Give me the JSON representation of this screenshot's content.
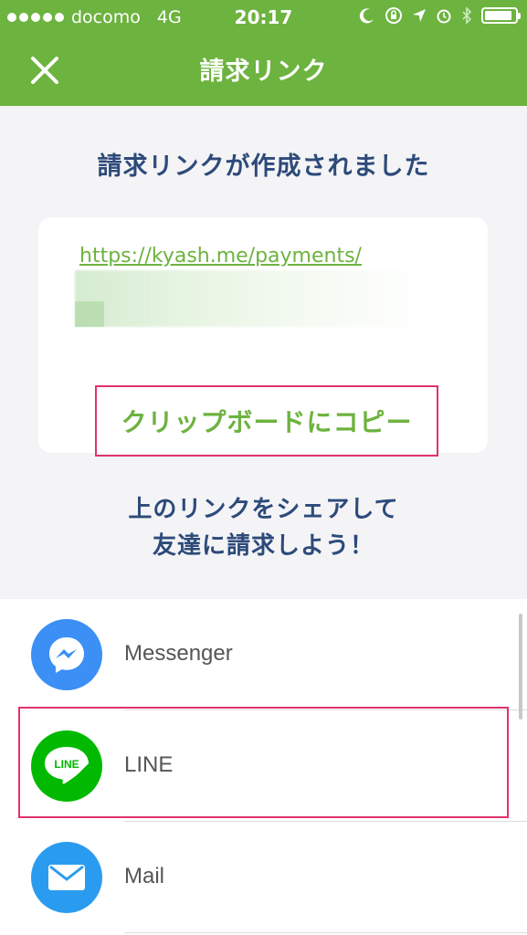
{
  "status_bar": {
    "carrier": "docomo",
    "network": "4G",
    "time": "20:17",
    "battery_level": 0.9
  },
  "nav": {
    "title": "請求リンク",
    "close_icon": "close-icon"
  },
  "main": {
    "headline": "請求リンクが作成されました",
    "link_text": "https://kyash.me/payments/",
    "copy_button_label": "クリップボードにコピー",
    "share_prompt_line1": "上のリンクをシェアして",
    "share_prompt_line2": "友達に請求しよう！"
  },
  "share_options": [
    {
      "label": "Messenger",
      "icon": "messenger-icon",
      "color": "#3b8ff5"
    },
    {
      "label": "LINE",
      "icon": "line-icon",
      "color": "#00b900",
      "icon_text": "LINE"
    },
    {
      "label": "Mail",
      "icon": "mail-icon",
      "color": "#2a9cf0"
    }
  ],
  "colors": {
    "accent": "#6db33f",
    "heading": "#2d4a7a",
    "highlight": "#e1336a"
  }
}
